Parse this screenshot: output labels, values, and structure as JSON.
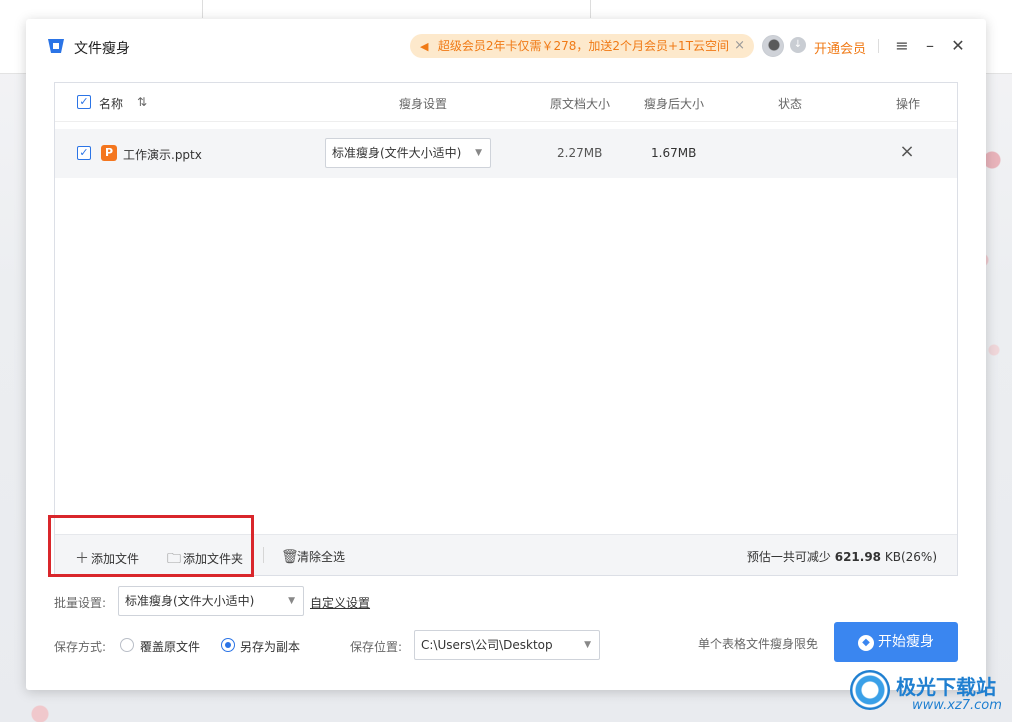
{
  "app": {
    "title": "文件瘦身",
    "promo": "超级会员2年卡仅需￥278，加送2个月会员+1T云空间",
    "promo_close": "×",
    "vip_label": "开通会员",
    "menu_icon": "menu-icon",
    "minimize_icon": "minimize-icon",
    "close_icon": "close-icon"
  },
  "table": {
    "headers": {
      "name": "名称",
      "sort": "⇅",
      "setting": "瘦身设置",
      "original_size": "原文档大小",
      "after_size": "瘦身后大小",
      "status": "状态",
      "action": "操作"
    },
    "rows": [
      {
        "checked": true,
        "file_type": "P",
        "file_name": "工作演示.pptx",
        "setting": "标准瘦身(文件大小适中)",
        "original_size": "2.27MB",
        "after_size": "1.67MB",
        "status": "",
        "delete_icon": "×"
      }
    ]
  },
  "footer": {
    "add_file": "添加文件",
    "add_folder": "添加文件夹",
    "clear_all": "清除全选",
    "estimate_prefix": "预估一共可减少",
    "estimate_value": "621.98",
    "estimate_suffix": "KB(26%)"
  },
  "batch": {
    "label": "批量设置:",
    "value": "标准瘦身(文件大小适中)",
    "custom": "自定义设置"
  },
  "save": {
    "mode_label": "保存方式:",
    "overwrite": "覆盖原文件",
    "save_copy": "另存为副本",
    "selected": "save_copy",
    "location_label": "保存位置:",
    "location_value": "C:\\Users\\公司\\Desktop"
  },
  "note": "单个表格文件瘦身限免",
  "start_button": "开始瘦身",
  "watermark": {
    "text": "极光下载站",
    "url": "www.xz7.com"
  },
  "colors": {
    "accent": "#3a86f0",
    "promo_text": "#f07a16",
    "highlight": "#d9262b"
  }
}
